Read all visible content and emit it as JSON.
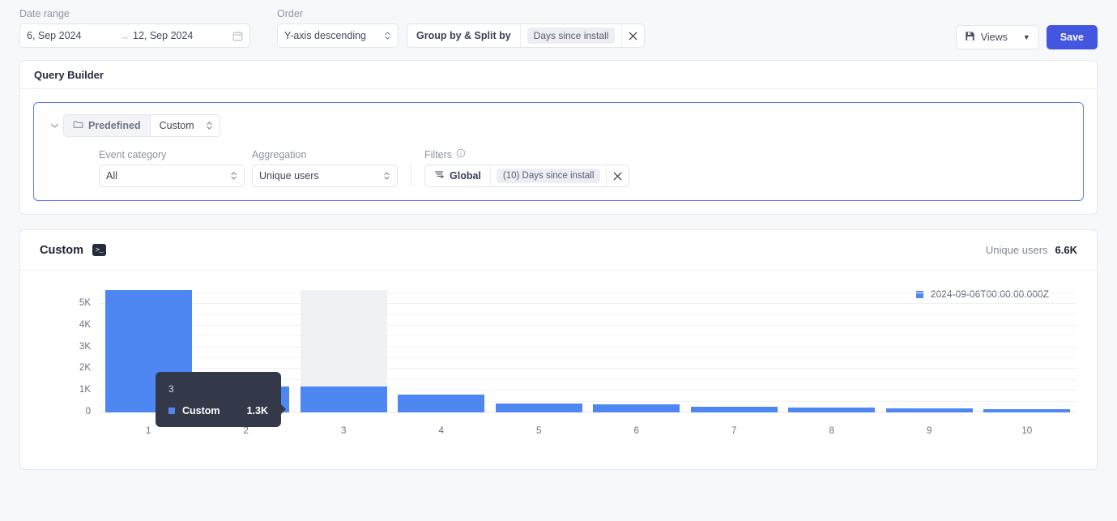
{
  "toolbar": {
    "date_range_label": "Date range",
    "date_from": "6, Sep 2024",
    "date_to": "12, Sep 2024",
    "date_arrow": "→",
    "calendar_icon": "calendar-icon",
    "order_label": "Order",
    "order_value": "Y-axis descending",
    "group_by_label": "Group by & Split by",
    "group_by_chip": "Days since install",
    "group_by_clear": "✕",
    "views_label": "Views",
    "views_icon": "floppy-disk-icon",
    "views_caret": "▼",
    "save_label": "Save"
  },
  "query_builder": {
    "title": "Query Builder",
    "collapse_icon": "chevron-down-icon",
    "mode_predefined": "Predefined",
    "mode_predefined_icon": "folder-icon",
    "mode_custom": "Custom",
    "event_category_label": "Event category",
    "event_category_value": "All",
    "aggregation_label": "Aggregation",
    "aggregation_value": "Unique users",
    "filters_label": "Filters",
    "filters_info_icon": "info-icon",
    "filters_global": "Global",
    "filters_global_icon": "filter-plus-icon",
    "filters_chip": "(10) Days since install",
    "filters_clear": "✕"
  },
  "chart_card": {
    "title": "Custom",
    "terminal_badge": ">_",
    "metric_name": "Unique users",
    "metric_value": "6.6K"
  },
  "tooltip": {
    "header": "3",
    "series_label": "Custom",
    "series_value": "1.3K"
  },
  "colors": {
    "bar": "#4f87f2",
    "accent": "#4356e0",
    "tooltip_bg": "#333948",
    "hover_column": "#f0f1f4"
  },
  "chart_data": {
    "type": "bar",
    "title": "Custom",
    "xlabel": "",
    "ylabel": "",
    "categories": [
      "1",
      "2",
      "3",
      "4",
      "5",
      "6",
      "7",
      "8",
      "9",
      "10"
    ],
    "series": [
      {
        "name": "2024-09-06T00:00:00.000Z",
        "color": "#4f87f2",
        "values": [
          5640,
          1200,
          1200,
          820,
          410,
          380,
          270,
          230,
          200,
          160
        ]
      }
    ],
    "legend": [
      "2024-09-06T00:00:00.000Z"
    ],
    "legend_position": "top-right",
    "yticks": [
      {
        "label": "0",
        "value": 0
      },
      {
        "label": "1K",
        "value": 1000
      },
      {
        "label": "2K",
        "value": 2000
      },
      {
        "label": "3K",
        "value": 3000
      },
      {
        "label": "4K",
        "value": 4000
      },
      {
        "label": "5K",
        "value": 5000
      }
    ],
    "ylim": [
      0,
      5600
    ],
    "grid": true,
    "hovered_category": "3",
    "hovered_value_label": "1.3K"
  }
}
